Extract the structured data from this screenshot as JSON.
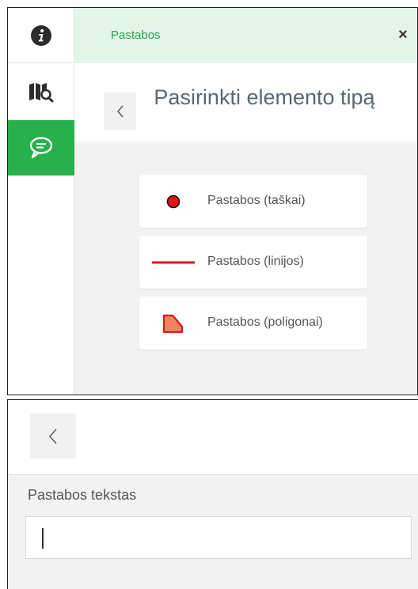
{
  "rail": {
    "items": [
      {
        "icon": "info-icon",
        "active": false
      },
      {
        "icon": "map-search-icon",
        "active": false
      },
      {
        "icon": "comment-icon",
        "active": true
      }
    ],
    "active_color": "#27b04c"
  },
  "header": {
    "title": "Pastabos",
    "close_label": "×"
  },
  "panel": {
    "title": "Pasirinkti elemento tipą",
    "back_icon": "chevron-left-icon",
    "options": [
      {
        "label": "Pastabos (taškai)",
        "icon": "point-icon"
      },
      {
        "label": "Pastabos (linijos)",
        "icon": "line-icon"
      },
      {
        "label": "Pastabos (poligonai)",
        "icon": "polygon-icon"
      }
    ]
  },
  "form": {
    "back_icon": "chevron-left-icon",
    "field_label": "Pastabos tekstas",
    "field_value": ""
  },
  "colors": {
    "accent": "#27b04c",
    "header_bg": "#e4f5ea",
    "marker_red": "#e0161b",
    "polygon_fill": "#f3825f"
  }
}
